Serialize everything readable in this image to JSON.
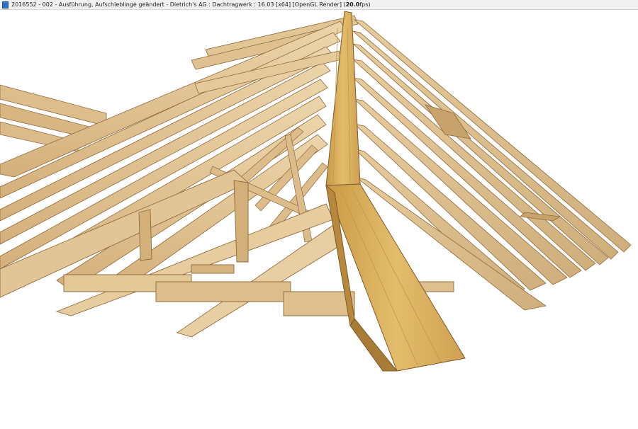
{
  "window": {
    "title_main": "2016552 - 002 - Ausführung, Aufschieblinge geändert - Dietrich's AG : Dachtragwerk : 16.03 [x64] [OpenGL Render] (",
    "title_fps": "20.0",
    "title_fps_suffix": "fps)"
  },
  "viewport": {
    "render_mode": "OpenGL Render",
    "subject": "hip roof timber frame 3D render",
    "icon": "cad-app-icon",
    "colors": {
      "background": "#ffffff",
      "timber_light": "#e9cfa3",
      "timber_mid": "#d9b782",
      "timber_dark": "#b89058",
      "hip_rafter": "#d9ad55",
      "edge": "#8f6a3a"
    }
  }
}
